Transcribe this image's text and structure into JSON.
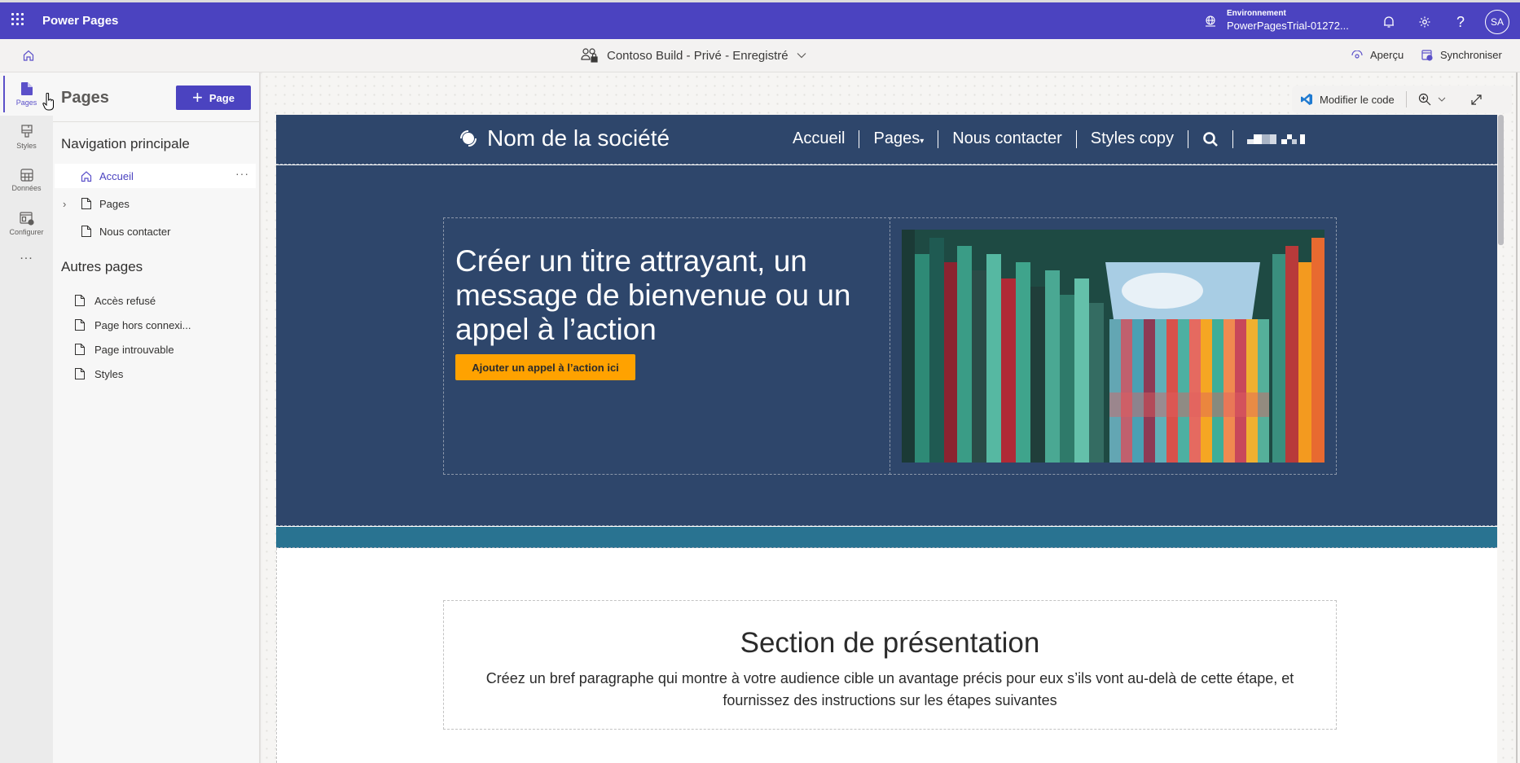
{
  "app": {
    "title": "Power Pages",
    "environment_label": "Environnement",
    "environment_value": "PowerPagesTrial-01272...",
    "user_initials": "SA"
  },
  "subbar": {
    "site_name": "Contoso Build - Privé - Enregistré",
    "preview_label": "Aperçu",
    "sync_label": "Synchroniser"
  },
  "rail": {
    "items": [
      {
        "label": "Pages",
        "icon": "page-icon",
        "active": true
      },
      {
        "label": "Styles",
        "icon": "paintbrush-icon",
        "active": false
      },
      {
        "label": "Données",
        "icon": "table-icon",
        "active": false
      },
      {
        "label": "Configurer",
        "icon": "settings-window-icon",
        "active": false
      }
    ],
    "more": "..."
  },
  "panel": {
    "title": "Pages",
    "add_button": "Page",
    "main_nav_title": "Navigation principale",
    "main_nav": [
      {
        "label": "Accueil",
        "icon": "home-icon",
        "selected": true,
        "expandable": false
      },
      {
        "label": "Pages",
        "icon": "page-icon",
        "selected": false,
        "expandable": true
      },
      {
        "label": "Nous contacter",
        "icon": "page-icon",
        "selected": false,
        "expandable": false
      }
    ],
    "other_title": "Autres pages",
    "other_pages": [
      {
        "label": "Accès refusé"
      },
      {
        "label": "Page hors connexi..."
      },
      {
        "label": "Page introuvable"
      },
      {
        "label": "Styles"
      }
    ],
    "row_more": "···"
  },
  "toolbar": {
    "edit_code": "Modifier le code"
  },
  "site": {
    "brand": "Nom de la société",
    "menu": [
      "Accueil",
      "Pages",
      "Nous contacter",
      "Styles copy"
    ],
    "hero_title": "Créer un titre attrayant, un message de bienvenue ou un appel à l’action",
    "cta": "Ajouter un appel à l’action ici",
    "section_title": "Section de présentation",
    "section_text": "Créez un bref paragraphe qui montre à votre audience cible un avantage précis pour eux s’ils vont au-delà de cette étape, et fournissez des instructions sur les étapes suivantes"
  },
  "colors": {
    "brand_purple": "#4b43c0",
    "site_navy": "#2e466b",
    "site_teal": "#297391",
    "cta_orange": "#ffa200"
  }
}
